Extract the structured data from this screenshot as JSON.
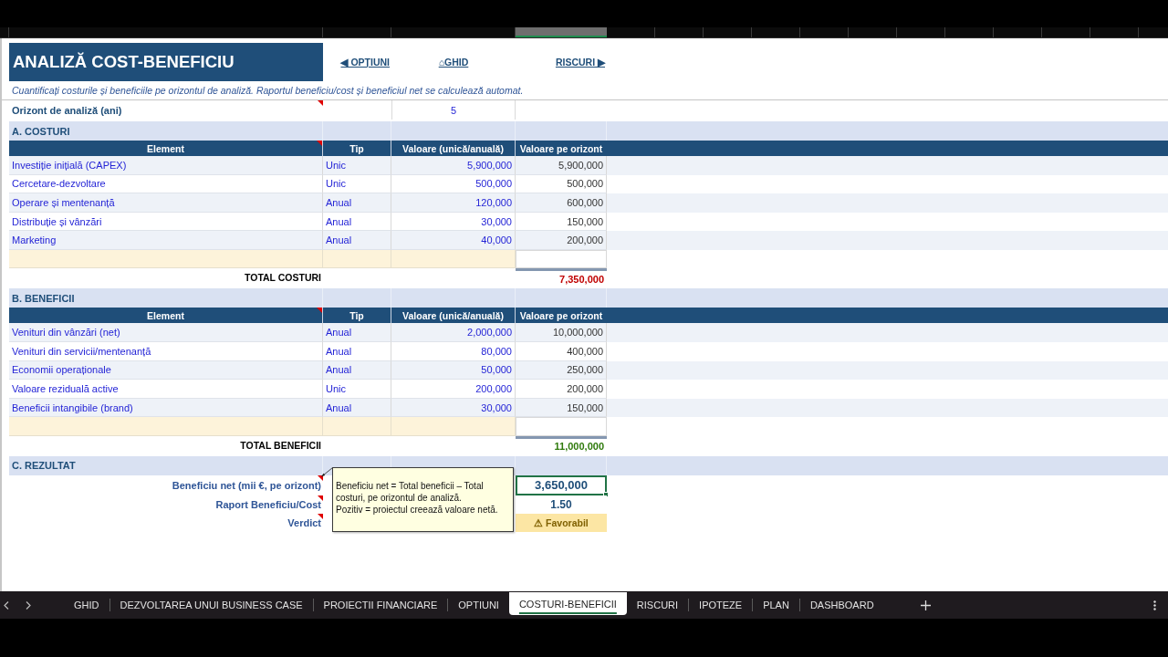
{
  "title": "ANALIZĂ COST-BENEFICIU",
  "nav_links": [
    "◀ OPȚIUNI",
    "⌂GHID",
    "RISCURI ▶"
  ],
  "subtitle": "Cuantificați costurile și beneficiile pe orizontul de analiză. Raportul beneficiu/cost și beneficiul net se calculează automat.",
  "horizon": {
    "label": "Orizont de analiză (ani)",
    "value": "5",
    "has_note": true
  },
  "sections": [
    {
      "heading": "A. COSTURI",
      "columns": [
        {
          "label": "Element",
          "has_note": true
        },
        {
          "label": "Tip",
          "has_note": false
        },
        {
          "label": "Valoare (unică/anuală)",
          "has_note": false
        },
        {
          "label": "Valoare pe orizont",
          "has_note": false
        }
      ],
      "rows": [
        {
          "element": "Investiție inițială (CAPEX)",
          "type": "Unic",
          "value": "5,900,000",
          "horizon_value": "5,900,000"
        },
        {
          "element": "Cercetare-dezvoltare",
          "type": "Unic",
          "value": "500,000",
          "horizon_value": "500,000"
        },
        {
          "element": "Operare și mentenanță",
          "type": "Anual",
          "value": "120,000",
          "horizon_value": "600,000"
        },
        {
          "element": "Distribuție și vânzări",
          "type": "Anual",
          "value": "30,000",
          "horizon_value": "150,000"
        },
        {
          "element": "Marketing",
          "type": "Anual",
          "value": "40,000",
          "horizon_value": "200,000"
        }
      ],
      "total": {
        "label": "TOTAL COSTURI",
        "value": "7,350,000",
        "color": "#c00000"
      }
    },
    {
      "heading": "B. BENEFICII",
      "columns": [
        {
          "label": "Element",
          "has_note": true
        },
        {
          "label": "Tip",
          "has_note": false
        },
        {
          "label": "Valoare (unică/anuală)",
          "has_note": false
        },
        {
          "label": "Valoare pe orizont",
          "has_note": false
        }
      ],
      "rows": [
        {
          "element": "Venituri din vânzări (net)",
          "type": "Anual",
          "value": "2,000,000",
          "horizon_value": "10,000,000"
        },
        {
          "element": "Venituri din servicii/mentenanță",
          "type": "Anual",
          "value": "80,000",
          "horizon_value": "400,000"
        },
        {
          "element": "Economii operaționale",
          "type": "Anual",
          "value": "50,000",
          "horizon_value": "250,000"
        },
        {
          "element": "Valoare reziduală active",
          "type": "Unic",
          "value": "200,000",
          "horizon_value": "200,000"
        },
        {
          "element": "Beneficii intangibile (brand)",
          "type": "Anual",
          "value": "30,000",
          "horizon_value": "150,000"
        }
      ],
      "total": {
        "label": "TOTAL BENEFICII",
        "value": "11,000,000",
        "color": "#2f7a0c"
      }
    }
  ],
  "result": {
    "heading": "C. REZULTAT",
    "rows": [
      {
        "label": "Beneficiu net (mii €, pe orizont)",
        "value": "3,650,000",
        "kind": "boxed",
        "has_note": true,
        "selected": true
      },
      {
        "label": "Raport Beneficiu/Cost",
        "value": "1.50",
        "kind": "plain",
        "has_note": true,
        "selected": false
      },
      {
        "label": "Verdict",
        "value": "⚠ Favorabil",
        "kind": "verdict",
        "has_note": true,
        "selected": false
      }
    ],
    "comment": [
      "Beneficiu net = Total beneficii – Total costuri, pe orizontul de analiză.",
      "Pozitiv = proiectul creează valoare netă."
    ]
  },
  "sheet_tabs": [
    {
      "label": "GHID",
      "selected": false
    },
    {
      "label": "DEZVOLTAREA UNUI BUSINESS CASE",
      "selected": false
    },
    {
      "label": "PROIECTII FINANCIARE",
      "selected": false
    },
    {
      "label": "OPTIUNI",
      "selected": false
    },
    {
      "label": "COSTURI-BENEFICII",
      "selected": true
    },
    {
      "label": "RISCURI",
      "selected": false
    },
    {
      "label": "IPOTEZE",
      "selected": false
    },
    {
      "label": "PLAN",
      "selected": false
    },
    {
      "label": "DASHBOARD",
      "selected": false
    }
  ]
}
